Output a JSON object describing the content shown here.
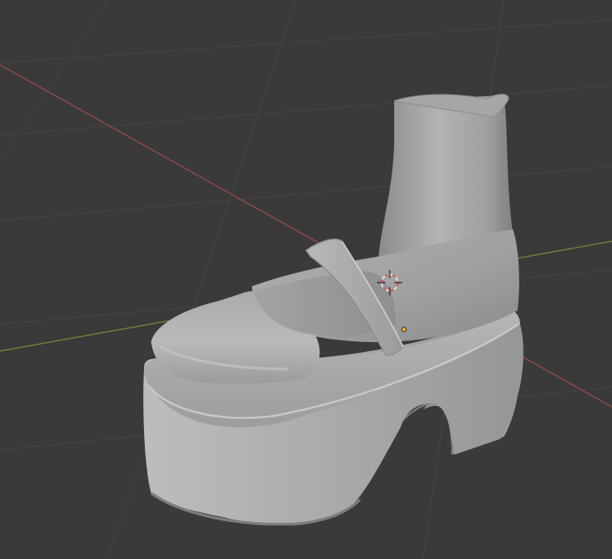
{
  "viewport": {
    "mode": "3d-viewport",
    "shading": "solid",
    "background_color": "#3a3a3a"
  },
  "colors": {
    "grid_line": "#454545",
    "axis_x": "#9a4a4a",
    "axis_y": "#6e8a3c",
    "mesh_base": "#9c9d9e",
    "mesh_light": "#c0c1c2",
    "mesh_shadow": "#7c7d7e",
    "cursor_ring": "#d8d8d8",
    "cursor_red": "#e0554e",
    "origin_dot": "#f5a623"
  },
  "objects": {
    "model": "platform-boot",
    "parts": [
      "boot-shaft",
      "boot-collar",
      "toe-box",
      "ankle-strap",
      "platform-sole",
      "heel"
    ]
  },
  "overlays": {
    "x_axis_visible": true,
    "y_axis_visible": true,
    "floor_grid_visible": true,
    "3d_cursor_visible": true,
    "object_origin_visible": true
  }
}
